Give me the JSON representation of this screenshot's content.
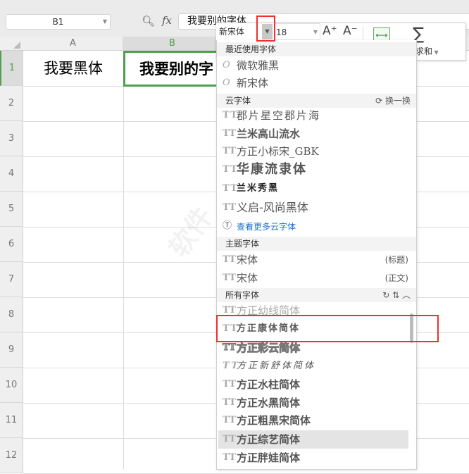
{
  "name_box": "B1",
  "formula_bar": {
    "fx_label": "fx",
    "value": "我要别的字体"
  },
  "columns": [
    "A",
    "B"
  ],
  "rows": [
    "1",
    "2",
    "3",
    "4",
    "5",
    "6",
    "7",
    "8",
    "9",
    "10",
    "11",
    "12"
  ],
  "cells": {
    "A1": "我要黑体",
    "B1": "我要别的字"
  },
  "mini_toolbar": {
    "font_name": "新宋体",
    "font_size": "18",
    "grow": "A⁺",
    "shrink": "A⁻",
    "sum_label": "求和"
  },
  "dropdown": {
    "recent": {
      "title": "最近使用字体",
      "items": [
        "微软雅黑",
        "新宋体"
      ]
    },
    "cloud": {
      "title": "云字体",
      "action": "换一换",
      "items": [
        "郡片星空郡片海",
        "兰米高山流水",
        "方正小标宋_GBK",
        "华康流隶体",
        "兰米秀黑",
        "义启-风尚黑体"
      ],
      "more_link": "查看更多云字体"
    },
    "theme": {
      "title": "主题字体",
      "items": [
        {
          "name": "宋体",
          "tag": "(标题)"
        },
        {
          "name": "宋体",
          "tag": "(正文)"
        }
      ]
    },
    "all": {
      "title": "所有字体",
      "items": [
        "方正幼线简体",
        "方正康体简体",
        "方正彩云简体",
        "方正新舒体简体",
        "方正水柱简体",
        "方正水黑简体",
        "方正粗黑宋简体",
        "方正综艺简体",
        "方正胖娃简体"
      ]
    }
  },
  "colors": {
    "selection": "#4ca14c",
    "highlight_box": "#f03030",
    "link": "#1e6fd0"
  }
}
